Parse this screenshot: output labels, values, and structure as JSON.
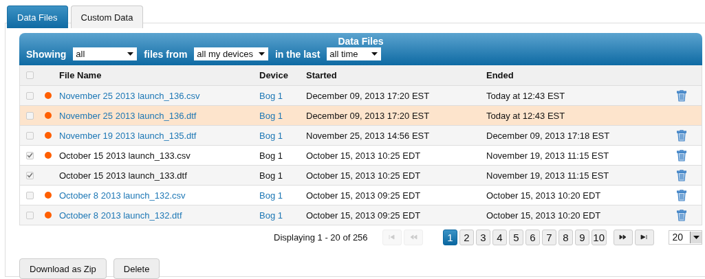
{
  "tabs": [
    {
      "label": "Data Files",
      "selected": true
    },
    {
      "label": "Custom Data",
      "selected": false
    }
  ],
  "panel": {
    "title": "Data Files",
    "filters": [
      {
        "label": "Showing",
        "value": "all"
      },
      {
        "label": "files from",
        "value": "all my devices"
      },
      {
        "label": "in the last",
        "value": "all time"
      }
    ]
  },
  "table": {
    "select_all_checked": false,
    "columns": [
      "File Name",
      "Device",
      "Started",
      "Ended"
    ],
    "rows": [
      {
        "checked": false,
        "flagged": true,
        "linked": true,
        "hovered": false,
        "deletable": true,
        "file_name": "November 25 2013 launch_136.csv",
        "device": "Bog 1",
        "started": "December 09, 2013 17:20 EST",
        "ended": "Today at 12:43 EST"
      },
      {
        "checked": false,
        "flagged": true,
        "linked": true,
        "hovered": true,
        "deletable": false,
        "file_name": "November 25 2013 launch_136.dtf",
        "device": "Bog 1",
        "started": "December 09, 2013 17:20 EST",
        "ended": "Today at 12:43 EST"
      },
      {
        "checked": false,
        "flagged": true,
        "linked": true,
        "hovered": false,
        "deletable": true,
        "file_name": "November 19 2013 launch_135.dtf",
        "device": "Bog 1",
        "started": "November 25, 2013 14:56 EST",
        "ended": "December 09, 2013 17:18 EST"
      },
      {
        "checked": true,
        "flagged": true,
        "linked": false,
        "hovered": false,
        "deletable": true,
        "file_name": "October 15 2013 launch_133.csv",
        "device": "Bog 1",
        "started": "October 15, 2013 10:25 EDT",
        "ended": "November 19, 2013 11:15 EST"
      },
      {
        "checked": true,
        "flagged": false,
        "linked": false,
        "hovered": false,
        "deletable": true,
        "file_name": "October 15 2013 launch_133.dtf",
        "device": "Bog 1",
        "started": "October 15, 2013 10:25 EDT",
        "ended": "November 19, 2013 11:15 EST"
      },
      {
        "checked": false,
        "flagged": true,
        "linked": true,
        "hovered": false,
        "deletable": true,
        "file_name": "October 8 2013 launch_132.csv",
        "device": "Bog 1",
        "started": "October 15, 2013 09:25 EDT",
        "ended": "October 15, 2013 10:20 EDT"
      },
      {
        "checked": false,
        "flagged": true,
        "linked": true,
        "hovered": false,
        "deletable": true,
        "file_name": "October 8 2013 launch_132.dtf",
        "device": "Bog 1",
        "started": "October 15, 2013 09:25 EDT",
        "ended": "October 15, 2013 10:20 EDT"
      }
    ]
  },
  "pagination": {
    "summary": "Displaying 1 - 20 of 256",
    "first_disabled": true,
    "prev_disabled": true,
    "pages": [
      {
        "label": "1",
        "selected": true
      },
      {
        "label": "2",
        "selected": false
      },
      {
        "label": "3",
        "selected": false
      },
      {
        "label": "4",
        "selected": false
      },
      {
        "label": "5",
        "selected": false
      },
      {
        "label": "6",
        "selected": false
      },
      {
        "label": "7",
        "selected": false
      },
      {
        "label": "8",
        "selected": false
      },
      {
        "label": "9",
        "selected": false
      },
      {
        "label": "10",
        "selected": false
      }
    ],
    "page_size": "20"
  },
  "buttons": [
    "Download as Zip",
    "Delete"
  ]
}
